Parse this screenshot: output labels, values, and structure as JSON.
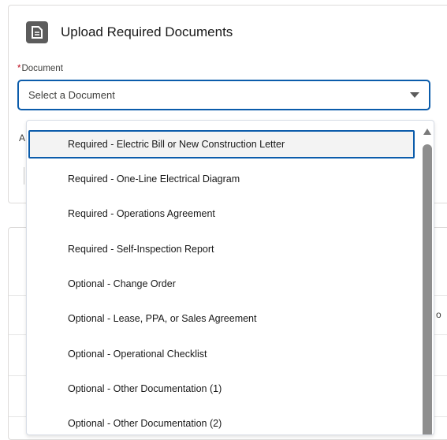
{
  "card": {
    "title": "Upload Required Documents",
    "icon": "document-icon"
  },
  "document_field": {
    "required_mark": "*",
    "label": "Document",
    "placeholder": "Select a Document"
  },
  "partial_text": {
    "left_label_fragment": "A",
    "right_column_fragment": "o"
  },
  "dropdown": {
    "options": [
      "Required - Electric Bill or New Construction Letter",
      "Required - One-Line Electrical Diagram",
      "Required - Operations Agreement",
      "Required - Self-Inspection Report",
      "Optional - Change Order",
      "Optional - Lease, PPA, or Sales Agreement",
      "Optional - Operational Checklist",
      "Optional - Other Documentation (1)",
      "Optional - Other Documentation (2)"
    ],
    "focused_index": 0
  },
  "colors": {
    "focus_border": "#0b5cab",
    "required": "#ba0517",
    "icon_bg": "#5c5c5c"
  }
}
